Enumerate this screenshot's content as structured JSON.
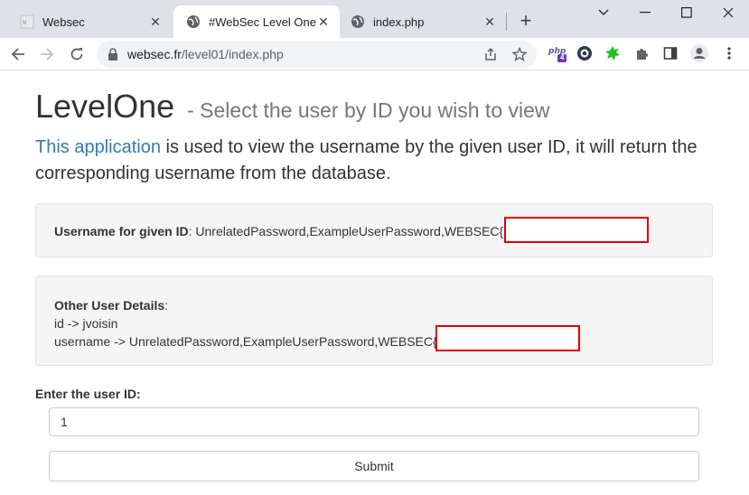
{
  "browser": {
    "tabs": [
      {
        "title": "Websec",
        "favicon": "websec-favicon",
        "active": false
      },
      {
        "title": "#WebSec Level One",
        "favicon": "globe-icon",
        "active": true
      },
      {
        "title": "index.php",
        "favicon": "globe-icon",
        "active": false
      }
    ],
    "close_glyph": "✕",
    "new_tab_glyph": "+",
    "url_host": "websec.fr",
    "url_path": "/level01/index.php",
    "extensions": [
      "php-extension-icon",
      "ghostery-icon",
      "green-extension-icon",
      "puzzle-icon",
      "sidepanel-icon",
      "profile-icon",
      "menu-icon"
    ],
    "php_badge_count": "4"
  },
  "page": {
    "title": "LevelOne",
    "subtitle": "- Select the user by ID you wish to view",
    "intro_link": "This application",
    "intro_text": " is used to view the username by the given user ID, it will return the corresponding username from the database.",
    "result": {
      "label": "Username for given ID",
      "value": ": UnrelatedPassword,ExampleUserPassword,WEBSEC{"
    },
    "details": {
      "label": "Other User Details",
      "colon": ":",
      "id_line": "id -> jvoisin",
      "username_line": "username -> UnrelatedPassword,ExampleUserPassword,WEBSEC{"
    },
    "form": {
      "label": "Enter the user ID:",
      "input_value": "1",
      "submit_label": "Submit"
    }
  },
  "colors": {
    "link": "#337ab7",
    "redaction": "#e00000"
  }
}
